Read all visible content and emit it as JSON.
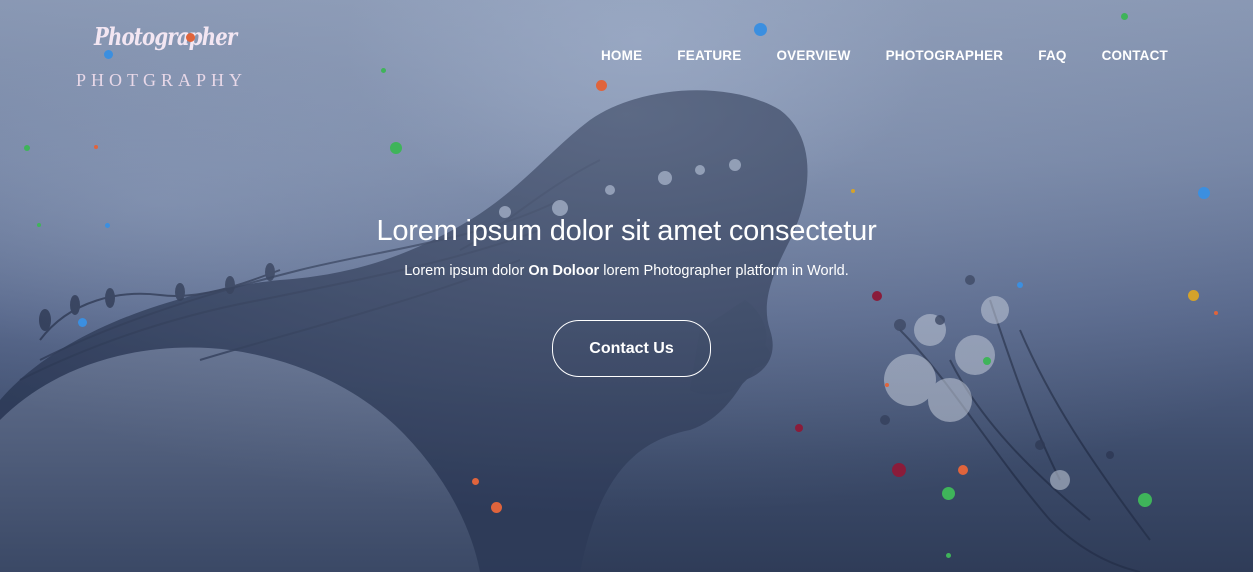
{
  "brand": {
    "title": "Photographer",
    "subtitle": "PHOTGRAPHY"
  },
  "nav": {
    "items": [
      {
        "label": "HOME"
      },
      {
        "label": "FEATURE"
      },
      {
        "label": "OVERVIEW"
      },
      {
        "label": "PHOTOGRAPHER"
      },
      {
        "label": "FAQ"
      },
      {
        "label": "CONTACT"
      }
    ]
  },
  "hero": {
    "headline": "Lorem ipsum dolor sit amet consectetur",
    "sub_before": "Lorem ipsum dolor ",
    "sub_bold": "On Doloor",
    "sub_after": " lorem Photographer platform in World.",
    "cta_label": "Contact Us"
  },
  "colors": {
    "particle_blue": "#3b8fe0",
    "particle_orange": "#e0643c",
    "particle_green": "#3fb45a",
    "particle_maroon": "#8a1c3a",
    "particle_gold": "#d4a22a",
    "logo_accent": "#e0643c"
  }
}
